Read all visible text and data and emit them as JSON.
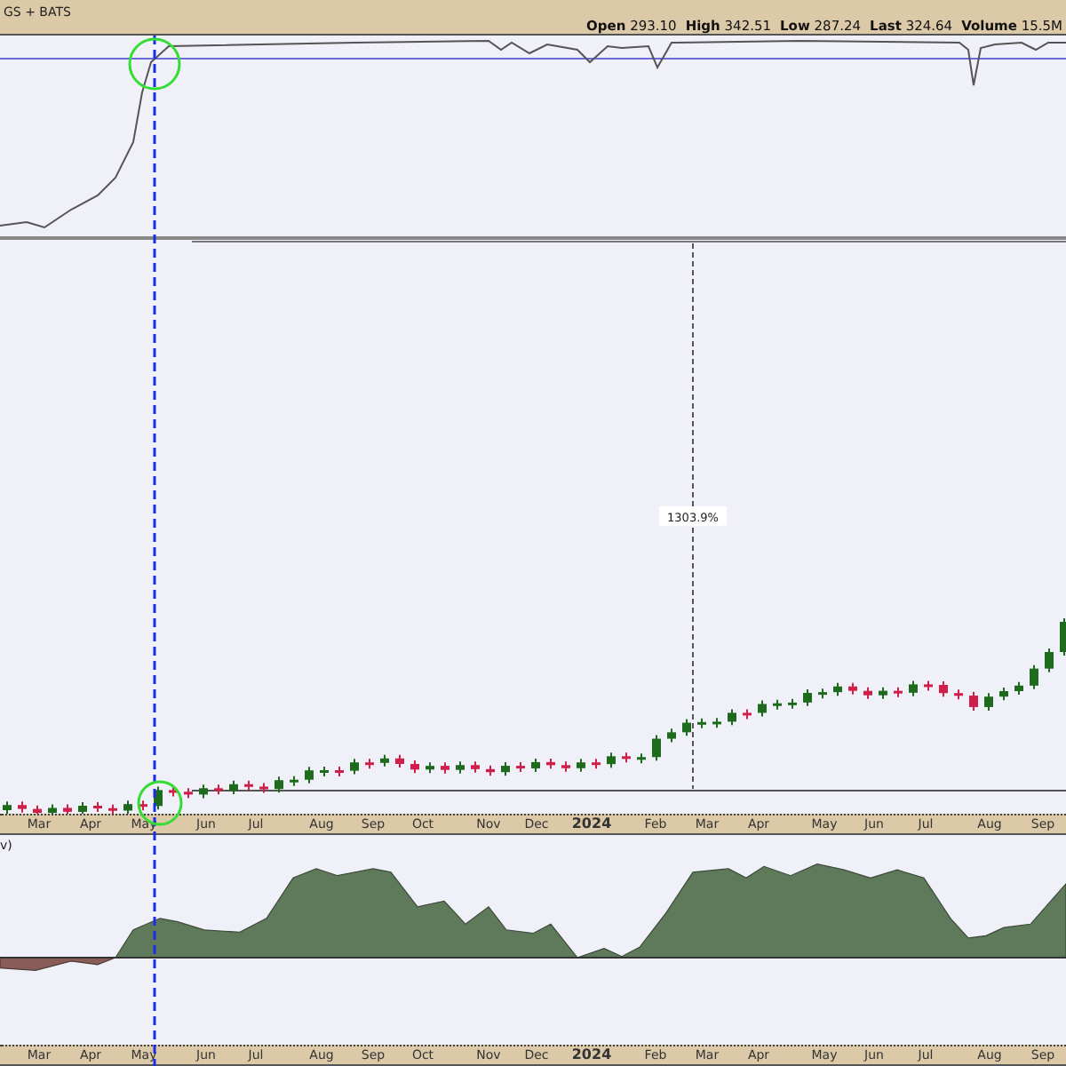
{
  "header": {
    "title": "GS + BATS",
    "quote": [
      {
        "label": "Open",
        "value": "293.10"
      },
      {
        "label": "High",
        "value": "342.51"
      },
      {
        "label": "Low",
        "value": "287.24"
      },
      {
        "label": "Last",
        "value": "324.64"
      },
      {
        "label": "Volume",
        "value": "15.5M"
      }
    ]
  },
  "main_panel": {
    "measure_label": "1303.9%"
  },
  "lower_panel": {
    "label": "v)"
  },
  "axis_labels": [
    {
      "text": "Mar",
      "kind": "month"
    },
    {
      "text": "Apr",
      "kind": "month"
    },
    {
      "text": "May",
      "kind": "month"
    },
    {
      "text": "Jun",
      "kind": "month"
    },
    {
      "text": "Jul",
      "kind": "month"
    },
    {
      "text": "Aug",
      "kind": "month"
    },
    {
      "text": "Sep",
      "kind": "month"
    },
    {
      "text": "Oct",
      "kind": "month"
    },
    {
      "text": "Nov",
      "kind": "month"
    },
    {
      "text": "Dec",
      "kind": "month"
    },
    {
      "text": "2024",
      "kind": "year"
    },
    {
      "text": "Feb",
      "kind": "month"
    },
    {
      "text": "Mar",
      "kind": "month"
    },
    {
      "text": "Apr",
      "kind": "month"
    },
    {
      "text": "May",
      "kind": "month"
    },
    {
      "text": "Jun",
      "kind": "month"
    },
    {
      "text": "Jul",
      "kind": "month"
    },
    {
      "text": "Aug",
      "kind": "month"
    },
    {
      "text": "Sep",
      "kind": "month"
    }
  ],
  "lower_axis_labels": [
    {
      "text": "Mar",
      "kind": "month"
    },
    {
      "text": "Apr",
      "kind": "month"
    },
    {
      "text": "May",
      "kind": "month"
    },
    {
      "text": "Jun",
      "kind": "month"
    },
    {
      "text": "Jul",
      "kind": "month"
    },
    {
      "text": "Aug",
      "kind": "month"
    },
    {
      "text": "Sep",
      "kind": "month"
    },
    {
      "text": "Oct",
      "kind": "month"
    },
    {
      "text": "Nov",
      "kind": "month"
    },
    {
      "text": "Dec",
      "kind": "month"
    },
    {
      "text": "2024",
      "kind": "year"
    },
    {
      "text": "Feb",
      "kind": "month"
    },
    {
      "text": "Mar",
      "kind": "month"
    },
    {
      "text": "Apr",
      "kind": "month"
    },
    {
      "text": "May",
      "kind": "month"
    },
    {
      "text": "Jun",
      "kind": "month"
    },
    {
      "text": "Jul",
      "kind": "month"
    },
    {
      "text": "Aug",
      "kind": "month"
    },
    {
      "text": "Sep",
      "kind": "month"
    }
  ]
}
